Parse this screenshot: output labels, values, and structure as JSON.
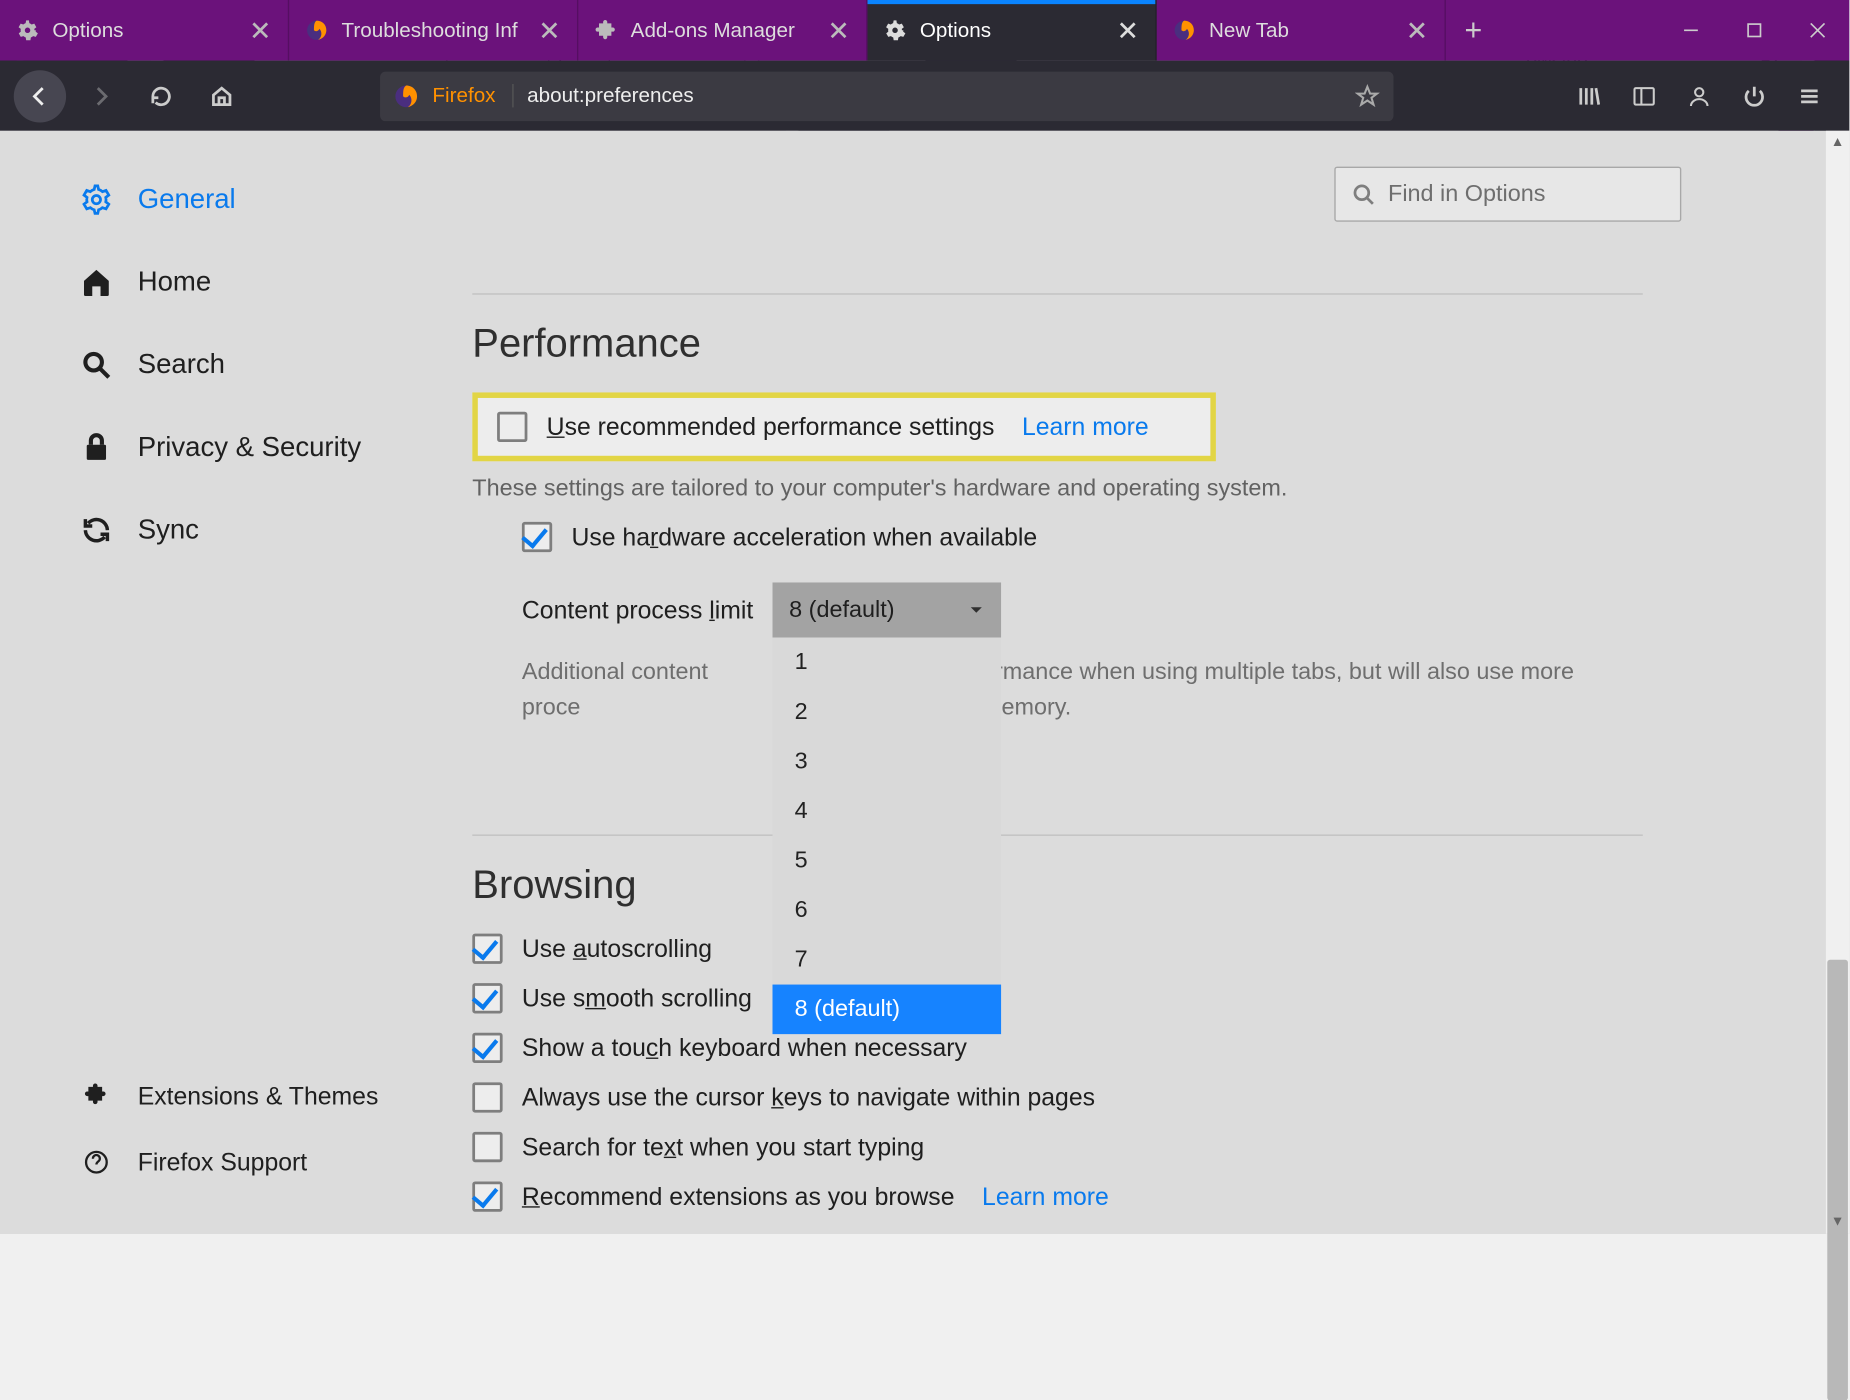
{
  "tabs": [
    {
      "label": "Options",
      "icon": "gear"
    },
    {
      "label": "Troubleshooting Inf",
      "icon": "firefox"
    },
    {
      "label": "Add-ons Manager",
      "icon": "puzzle"
    },
    {
      "label": "Options",
      "icon": "gear",
      "active": true
    },
    {
      "label": "New Tab",
      "icon": "firefox"
    }
  ],
  "newtab_plus": "+",
  "urlbar": {
    "brand": "Firefox",
    "url": "about:preferences"
  },
  "search": {
    "placeholder": "Find in Options"
  },
  "sidebar": {
    "items": [
      {
        "label": "General",
        "icon": "gear"
      },
      {
        "label": "Home",
        "icon": "home"
      },
      {
        "label": "Search",
        "icon": "search"
      },
      {
        "label": "Privacy & Security",
        "icon": "lock"
      },
      {
        "label": "Sync",
        "icon": "sync"
      }
    ],
    "footer": [
      {
        "label": "Extensions & Themes",
        "icon": "puzzle"
      },
      {
        "label": "Firefox Support",
        "icon": "help"
      }
    ]
  },
  "performance": {
    "heading": "Performance",
    "recommended_label": "Use recommended performance settings",
    "learn_more": "Learn more",
    "recommended_desc": "These settings are tailored to your computer's hardware and operating system.",
    "hw_accel_label": "Use hardware acceleration when available",
    "process_limit_label": "Content process limit",
    "process_limit_value": "8 (default)",
    "process_options": [
      "1",
      "2",
      "3",
      "4",
      "5",
      "6",
      "7",
      "8 (default)"
    ],
    "note_before": "Additional content proce",
    "note_after": "ormance when using multiple tabs, but will also use more memory."
  },
  "browsing": {
    "heading": "Browsing",
    "autoscroll": "Use autoscrolling",
    "smooth": "Use smooth scrolling",
    "touch": "Show a touch keyboard when necessary",
    "cursor": "Always use the cursor keys to navigate within pages",
    "searchtext": "Search for text when you start typing",
    "recommend": "Recommend extensions as you browse",
    "learn_more": "Learn more"
  }
}
